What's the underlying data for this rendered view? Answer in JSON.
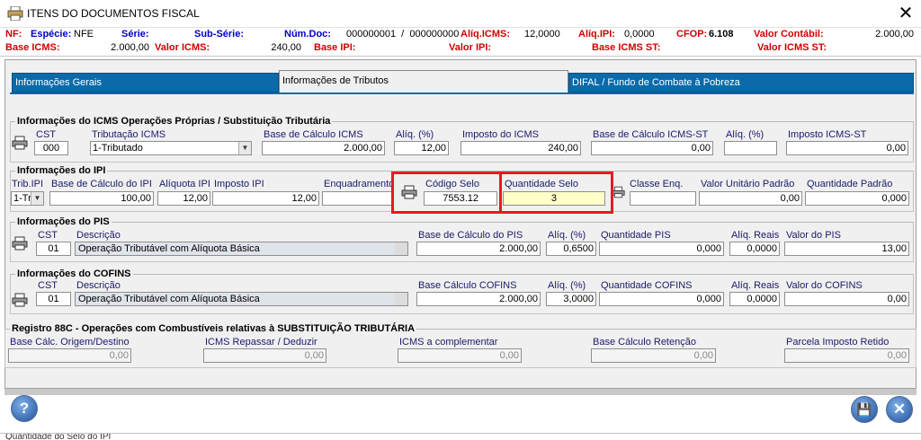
{
  "window": {
    "title": "ITENS DO DOCUMENTOS FISCAL",
    "close_glyph": "✕"
  },
  "header": {
    "nf_label": "NF:",
    "especie_label": "Espécie:",
    "especie": "NFE",
    "serie_label": "Série:",
    "sub_serie_label": "Sub-Série:",
    "num_doc_label": "Núm.Doc:",
    "num_doc": "000000001  /  000000000",
    "aliq_icms_label": "Alíq.ICMS:",
    "aliq_icms": "12,0000",
    "aliq_ipi_label": "Alíq.IPI:",
    "aliq_ipi": "0,0000",
    "cfop_label": "CFOP:",
    "cfop": "6.108",
    "valor_contabil_label": "Valor Contábil:",
    "valor_contabil": "2.000,00",
    "base_icms_label": "Base ICMS:",
    "base_icms": "2.000,00",
    "valor_icms_label": "Valor ICMS:",
    "valor_icms": "240,00",
    "base_ipi_label": "Base IPI:",
    "valor_ipi_label": "Valor IPI:",
    "base_icms_st_label": "Base ICMS ST:",
    "valor_icms_st_label": "Valor ICMS ST:"
  },
  "tabs": [
    {
      "label": "Informações Gerais"
    },
    {
      "label": "Informações de Tributos"
    },
    {
      "label": "DIFAL / Fundo de Combate à Pobreza"
    }
  ],
  "icms": {
    "title": "Informações do ICMS Operações Próprias / Substituição Tributária",
    "cst_label": "CST",
    "cst": "000",
    "trib_label": "Tributação ICMS",
    "trib": "1-Tributado",
    "base_label": "Base de Cálculo ICMS",
    "base": "2.000,00",
    "aliq_label": "Alíq. (%)",
    "aliq": "12,00",
    "imposto_label": "Imposto do ICMS",
    "imposto": "240,00",
    "base_st_label": "Base de Cálculo ICMS-ST",
    "base_st": "0,00",
    "aliq_st_label": "Alíq. (%)",
    "aliq_st": "",
    "imposto_st_label": "Imposto ICMS-ST",
    "imposto_st": "0,00"
  },
  "ipi": {
    "title": "Informações do IPI",
    "trib_label": "Trib.IPI",
    "trib": "1-Tr",
    "base_label": "Base de Cálculo do IPI",
    "base": "100,00",
    "aliq_label": "Alíquota IPI",
    "aliq": "12,00",
    "imposto_label": "Imposto IPI",
    "imposto": "12,00",
    "enq_label": "Enquadramento",
    "enq": "",
    "codigo_selo_label": "Código Selo",
    "codigo_selo": "7553.12",
    "qtd_selo_label": "Quantidade Selo",
    "qtd_selo": "3",
    "classe_label": "Classe Enq.",
    "classe": "",
    "vunit_label": "Valor Unitário Padrão",
    "vunit": "0,00",
    "qtd_padrao_label": "Quantidade Padrão",
    "qtd_padrao": "0,000"
  },
  "pis": {
    "title": "Informações do PIS",
    "cst_label": "CST",
    "cst": "01",
    "desc_label": "Descrição",
    "desc": "Operação Tributável com Alíquota Básica",
    "base_label": "Base de Cálculo do PIS",
    "base": "2.000,00",
    "aliq_label": "Alíq. (%)",
    "aliq": "0,6500",
    "qtd_label": "Quantidade PIS",
    "qtd": "0,000",
    "aliq_reais_label": "Alíq. Reais",
    "aliq_reais": "0,0000",
    "valor_label": "Valor do PIS",
    "valor": "13,00"
  },
  "cofins": {
    "title": "Informações do COFINS",
    "cst_label": "CST",
    "cst": "01",
    "desc_label": "Descrição",
    "desc": "Operação Tributável com Alíquota Básica",
    "base_label": "Base Cálculo COFINS",
    "base": "2.000,00",
    "aliq_label": "Alíq. (%)",
    "aliq": "3,0000",
    "qtd_label": "Quantidade COFINS",
    "qtd": "0,000",
    "aliq_reais_label": "Alíq. Reais",
    "aliq_reais": "0,0000",
    "valor_label": "Valor do COFINS",
    "valor": "0,00"
  },
  "reg88c": {
    "title": "Registro 88C - Operações com Combustíveis relativas à SUBSTITUIÇÃO TRIBUTÁRIA",
    "base_label": "Base Cálc. Origem/Destino",
    "base": "0,00",
    "repassar_label": "ICMS Repassar / Deduzir",
    "repassar": "0,00",
    "complementar_label": "ICMS a complementar",
    "complementar": "0,00",
    "retencao_label": "Base Cálculo Retenção",
    "retencao": "0,00",
    "parcela_label": "Parcela Imposto Retido",
    "parcela": "0,00"
  },
  "buttons": {
    "help": "?",
    "save": "💾",
    "close": "✕"
  },
  "status": "Quantidade do Selo do IPI"
}
